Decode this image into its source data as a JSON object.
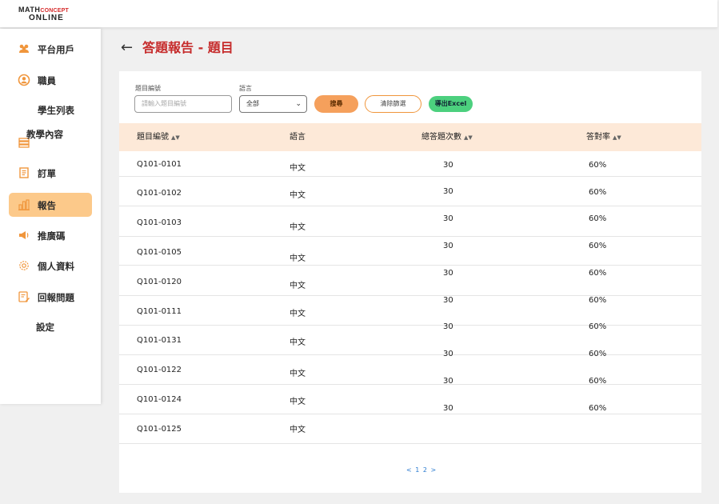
{
  "logo": {
    "line1_prefix": "MATH",
    "line1_suffix": "CONCEPT",
    "line2": "ONLINE"
  },
  "sidebar": {
    "items": [
      {
        "label": "平台用戶",
        "icon": "users-icon"
      },
      {
        "label": "職員",
        "icon": "user-circle-icon"
      },
      {
        "label": "學生列表",
        "icon": ""
      },
      {
        "label": "教學內容",
        "icon": "book-stack-icon"
      },
      {
        "label": "訂單",
        "icon": "receipt-icon"
      },
      {
        "label": "報告",
        "icon": "bar-chart-icon"
      },
      {
        "label": "推廣碼",
        "icon": "megaphone-icon"
      },
      {
        "label": "個人資料",
        "icon": "gear-icon"
      },
      {
        "label": "回報問題",
        "icon": "report-edit-icon"
      },
      {
        "label": "設定",
        "icon": ""
      }
    ],
    "active_index": 5
  },
  "header": {
    "back_glyph": "←",
    "title": "答題報告 - 題目"
  },
  "filters": {
    "id_label": "題目編號",
    "id_placeholder": "請輸入題目編號",
    "lang_label": "語言",
    "lang_value": "全部",
    "search_label": "搜尋",
    "clear_label": "清除篩選",
    "export_label": "導出Excel"
  },
  "table": {
    "headers": [
      "題目編號",
      "語言",
      "總答題次數",
      "答對率"
    ],
    "ids": [
      "Q101-0101",
      "Q101-0102",
      "Q101-0103",
      "Q101-0105",
      "Q101-0120",
      "Q101-0111",
      "Q101-0131",
      "Q101-0122",
      "Q101-0124",
      "Q101-0125"
    ],
    "langs": [
      "中文",
      "中文",
      "中文",
      "中文",
      "中文",
      "中文",
      "中文",
      "中文",
      "中文",
      "中文"
    ],
    "counts": [
      "30",
      "30",
      "30",
      "30",
      "30",
      "30",
      "30",
      "30",
      "30",
      "30"
    ],
    "rates": [
      "60%",
      "60%",
      "60%",
      "60%",
      "60%",
      "60%",
      "60%",
      "60%",
      "60%",
      "60%"
    ]
  },
  "pagination": {
    "text": "< 1 2 >"
  },
  "colors": {
    "accent": "#c62c2c",
    "orange": "#f5a05c",
    "active_nav": "#fcc98a",
    "excel": "#4cd07e",
    "header_row": "#fde9d8"
  }
}
